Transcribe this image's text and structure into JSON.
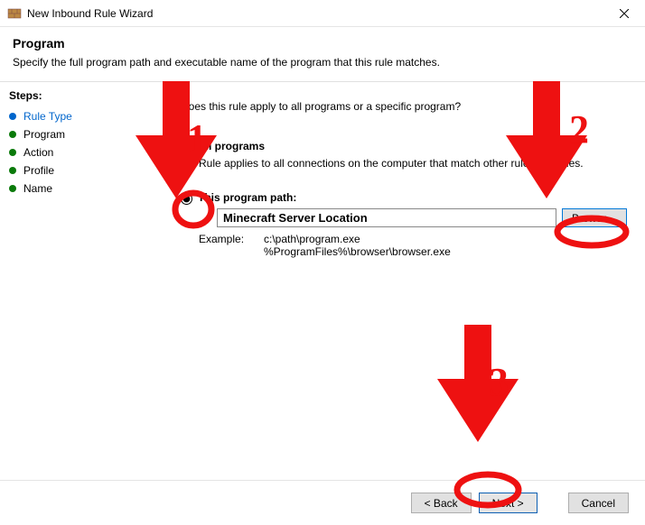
{
  "window": {
    "title": "New Inbound Rule Wizard"
  },
  "header": {
    "title": "Program",
    "subtitle": "Specify the full program path and executable name of the program that this rule matches."
  },
  "sidebar": {
    "steps_label": "Steps:",
    "items": [
      {
        "label": "Rule Type"
      },
      {
        "label": "Program"
      },
      {
        "label": "Action"
      },
      {
        "label": "Profile"
      },
      {
        "label": "Name"
      }
    ]
  },
  "main": {
    "question": "Does this rule apply to all programs or a specific program?",
    "radio_all": {
      "label": "All programs",
      "desc": "Rule applies to all connections on the computer that match other rule properties."
    },
    "radio_path": {
      "label": "This program path:"
    },
    "path_value": "Minecraft Server Location",
    "browse_label": "Browse...",
    "example_label": "Example:",
    "example_values": "c:\\path\\program.exe\n%ProgramFiles%\\browser\\browser.exe"
  },
  "footer": {
    "back": "< Back",
    "next": "Next >",
    "cancel": "Cancel"
  },
  "annotations": {
    "n1": "1",
    "n2": "2",
    "n3": "3"
  }
}
